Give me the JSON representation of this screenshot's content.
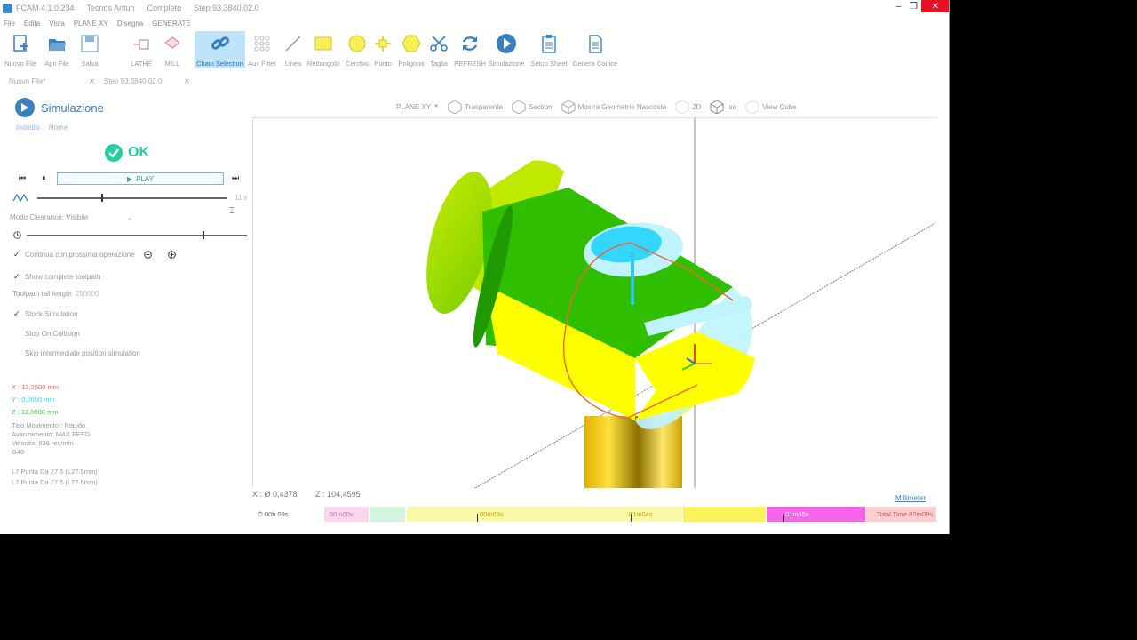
{
  "window": {
    "title_parts": [
      "FCAM 4.1.0.234",
      "Tecnos Antun",
      "Completo",
      "Step 93.3840.02.0"
    ]
  },
  "menu": [
    "File",
    "Edita",
    "Vista",
    "PLANE XY",
    "Disegna",
    "GENERATE"
  ],
  "ribbon": [
    {
      "label": "Nuovo File",
      "icon": "new-file-icon"
    },
    {
      "label": "Apri File",
      "icon": "open-folder-icon"
    },
    {
      "label": "Salva",
      "icon": "save-icon"
    },
    {
      "label": "LATHE",
      "icon": "lathe-icon"
    },
    {
      "label": "MILL",
      "icon": "mill-icon"
    },
    {
      "label": "Chain Selection",
      "icon": "chain-icon"
    },
    {
      "label": "Aux Filter",
      "icon": "grid-filter-icon"
    },
    {
      "label": "Linea",
      "icon": "line-icon"
    },
    {
      "label": "Rettangolo",
      "icon": "rectangle-icon"
    },
    {
      "label": "Cerchio",
      "icon": "circle-icon"
    },
    {
      "label": "Punto",
      "icon": "point-icon"
    },
    {
      "label": "Poligono",
      "icon": "polygon-icon"
    },
    {
      "label": "Taglia",
      "icon": "scissors-icon"
    },
    {
      "label": "REFRESH",
      "icon": "refresh-icon"
    },
    {
      "label": "Simulazione",
      "icon": "play-circle-icon"
    },
    {
      "label": "Setup Sheet",
      "icon": "clipboard-icon"
    },
    {
      "label": "Genera Codice",
      "icon": "document-icon"
    }
  ],
  "tabs": [
    {
      "label": "Nuovo File*"
    },
    {
      "label": "Step 93.3840.02.0"
    }
  ],
  "panel": {
    "title": "Simulazione",
    "breadcrumb": [
      "Indietro",
      "Home"
    ],
    "status": "OK",
    "play_label": "PLAY",
    "speed_value": "11 x",
    "mode_label": "Modo Clearance: Visibile",
    "continue_label": "Continua con prossima operazione",
    "show_toolpath_label": "Show complete toolpath",
    "tail_label": "Toolpath tail length",
    "tail_value": "250000",
    "stock_sim_label": "Stock Simulation",
    "stop_collision_label": "Stop On Collision",
    "skip_label": "Skip intermediate position simulation",
    "x_val": "X : 13,2500 mm",
    "y_val": "Y : 0,0000 mm",
    "z_val": "Z : 12,0000 mm",
    "info_lines": [
      "Tipo Movimento : Rapido",
      "Avanzamento: MAX FEED",
      "Velocita: 926 rev/min",
      "G40"
    ],
    "point_lines": [
      "L7 Punta Da 27.5 (L27.5mm)",
      "L7 Punta Da 27.5 (L27.5mm)"
    ]
  },
  "viewport_toolbar": {
    "plane": "PLANE XY",
    "items": [
      "Trasparente",
      "Section",
      "Mostra Geometrie Nascoste",
      "2D",
      "Iso",
      "View Cube"
    ]
  },
  "status": {
    "x_coord": "X : Ø 0,4378",
    "z_coord": "Z : 104,4595",
    "units": "Millimeter"
  },
  "timeline": {
    "elapsed": "00h 09s",
    "segments": [
      "00m00s",
      "",
      "00m03s",
      "01m04s",
      "",
      "01m55s",
      "Total Time 02m08s"
    ]
  },
  "colors": {
    "accent": "#3a7fc2",
    "ok_green": "#22cfa0",
    "x_red": "#ff5a5a",
    "y_cyan": "#33d6ff",
    "z_green": "#3fcf3f",
    "part_green": "#33cc00",
    "part_yellow": "#ffff00",
    "part_cyan": "#bff4ff",
    "toolpath": "#ee6633"
  }
}
